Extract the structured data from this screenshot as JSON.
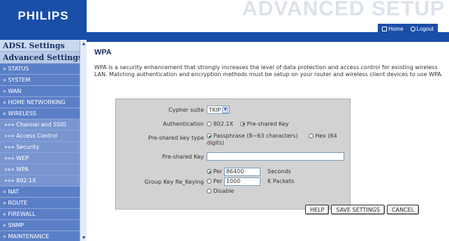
{
  "header": {
    "logo": "PHILIPS",
    "title": "ADVANCED SETUP",
    "home_label": "Home",
    "logout_label": "Logout",
    "brand_color": "#1a4ea8"
  },
  "sidebar": {
    "headings": [
      "ADSL Settings",
      "Advanced Settings"
    ],
    "items": [
      "» STATUS",
      "» SYSTEM",
      "» WAN",
      "» HOME NETWORKING",
      "» WIRELESS",
      "»»» Channel and SSID",
      "»»» Access Control",
      "»»» Security",
      "»»» WEP",
      "»»» WPA",
      "»»» 802.1X",
      "» NAT",
      "» ROUTE",
      "» FIREWALL",
      "» SNMP",
      "» MAINTENANCE"
    ]
  },
  "main": {
    "title": "WPA",
    "description": "WPA is a security enhancement that strongly increases the level of data protection and access control for existing wireless LAN. Matching authentication and encryption methods must be setup on your router and wireless client devices to use WPA.",
    "form": {
      "cypher_suite_label": "Cypher suite",
      "cypher_suite_value": "TKIP",
      "authentication_label": "Authentication",
      "auth_option_1": "802.1X",
      "auth_option_2": "Pre-shared Key",
      "psk_type_label": "Pre-shared key type",
      "psk_type_option_1": "Passphrase (8~63 characters)",
      "psk_type_option_2": "Hex (64 digits)",
      "psk_label": "Pre-shared Key",
      "psk_value": "",
      "group_key_label": "Group Key Re_Keying",
      "rekey_per_label": "Per",
      "rekey_seconds_value": "86400",
      "rekey_seconds_unit": "Seconds",
      "rekey_packets_value": "1000",
      "rekey_packets_unit": "K Packets",
      "rekey_disable_label": "Disable"
    },
    "buttons": {
      "help": "HELP",
      "save": "SAVE SETTINGS",
      "cancel": "CANCEL"
    }
  }
}
